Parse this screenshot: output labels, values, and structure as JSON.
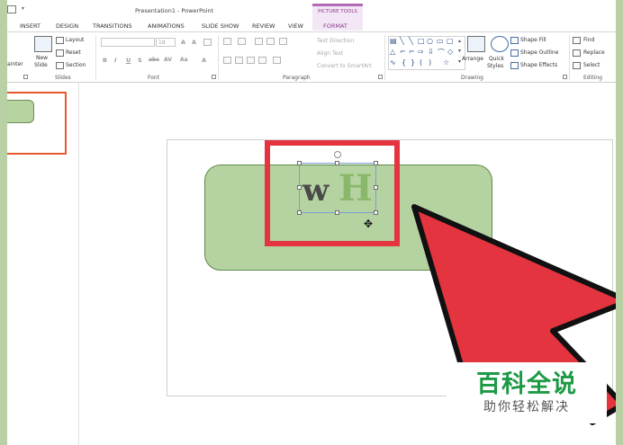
{
  "window": {
    "title": "Presentation1 - PowerPoint",
    "contextual_group": "PICTURE TOOLS"
  },
  "tabs": [
    "INSERT",
    "DESIGN",
    "TRANSITIONS",
    "ANIMATIONS",
    "SLIDE SHOW",
    "REVIEW",
    "VIEW",
    "FORMAT"
  ],
  "ribbon": {
    "slides": {
      "left_partial": "ainter",
      "new_slide": [
        "New",
        "Slide"
      ],
      "layout": "Layout",
      "reset": "Reset",
      "section": "Section",
      "label": "Slides"
    },
    "font": {
      "size": "18",
      "buttons": [
        "B",
        "I",
        "U",
        "S",
        "abc",
        "AV",
        "Aa"
      ],
      "label": "Font"
    },
    "paragraph": {
      "text_direction": "Text Direction",
      "align_text": "Align Text",
      "convert_smartart": "Convert to SmartArt",
      "label": "Paragraph"
    },
    "drawing": {
      "arrange": "Arrange",
      "quick_styles": [
        "Quick",
        "Styles"
      ],
      "shape_fill": "Shape Fill",
      "shape_outline": "Shape Outline",
      "shape_effects": "Shape Effects",
      "label": "Drawing"
    },
    "editing": {
      "find": "Find",
      "replace": "Replace",
      "select": "Select",
      "label": "Editing"
    }
  },
  "slide": {
    "logo_left": "w",
    "logo_right": "H"
  },
  "watermark": {
    "title": "百科全说",
    "subtitle": "助你轻松解决"
  },
  "colors": {
    "accent_red": "#e4343f",
    "shape_green": "#b5d2a1",
    "thumb_border": "#e7582d"
  }
}
